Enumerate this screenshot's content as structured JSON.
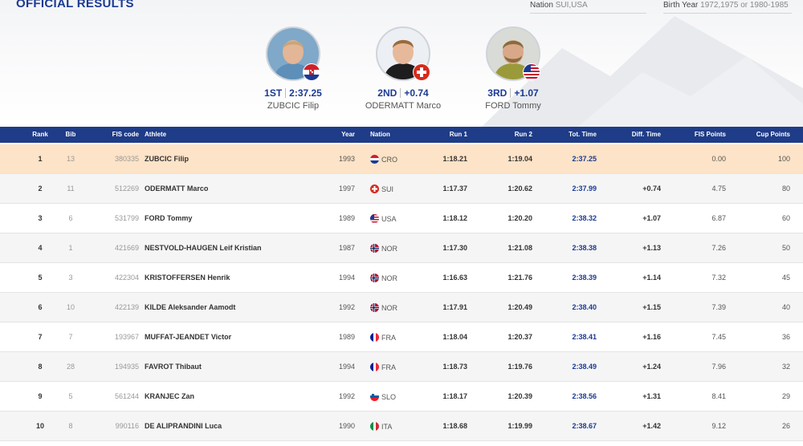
{
  "page": {
    "title": "OFFICIAL RESULTS"
  },
  "filters": {
    "nation_label": "Nation",
    "nation_value": "SUI,USA",
    "birth_label": "Birth Year",
    "birth_value": "1972,1975 or 1980-1985"
  },
  "podium": [
    {
      "place": "1ST",
      "time": "2:37.25",
      "name": "ZUBCIC Filip",
      "flag": "CRO"
    },
    {
      "place": "2ND",
      "time": "+0.74",
      "name": "ODERMATT Marco",
      "flag": "SUI"
    },
    {
      "place": "3RD",
      "time": "+1.07",
      "name": "FORD Tommy",
      "flag": "USA"
    }
  ],
  "table": {
    "headers": {
      "rank": "Rank",
      "bib": "Bib",
      "fis_code": "FIS code",
      "athlete": "Athlete",
      "year": "Year",
      "nation": "Nation",
      "run1": "Run 1",
      "run2": "Run 2",
      "tot": "Tot. Time",
      "diff": "Diff. Time",
      "fis_points": "FIS Points",
      "cup_points": "Cup Points"
    },
    "rows": [
      {
        "rank": "1",
        "bib": "13",
        "fis": "380335",
        "athlete": "ZUBCIC Filip",
        "year": "1993",
        "nation": "CRO",
        "run1": "1:18.21",
        "run2": "1:19.04",
        "tot": "2:37.25",
        "diff": "",
        "fisp": "0.00",
        "cup": "100"
      },
      {
        "rank": "2",
        "bib": "11",
        "fis": "512269",
        "athlete": "ODERMATT Marco",
        "year": "1997",
        "nation": "SUI",
        "run1": "1:17.37",
        "run2": "1:20.62",
        "tot": "2:37.99",
        "diff": "+0.74",
        "fisp": "4.75",
        "cup": "80"
      },
      {
        "rank": "3",
        "bib": "6",
        "fis": "531799",
        "athlete": "FORD Tommy",
        "year": "1989",
        "nation": "USA",
        "run1": "1:18.12",
        "run2": "1:20.20",
        "tot": "2:38.32",
        "diff": "+1.07",
        "fisp": "6.87",
        "cup": "60"
      },
      {
        "rank": "4",
        "bib": "1",
        "fis": "421669",
        "athlete": "NESTVOLD-HAUGEN Leif Kristian",
        "year": "1987",
        "nation": "NOR",
        "run1": "1:17.30",
        "run2": "1:21.08",
        "tot": "2:38.38",
        "diff": "+1.13",
        "fisp": "7.26",
        "cup": "50"
      },
      {
        "rank": "5",
        "bib": "3",
        "fis": "422304",
        "athlete": "KRISTOFFERSEN Henrik",
        "year": "1994",
        "nation": "NOR",
        "run1": "1:16.63",
        "run2": "1:21.76",
        "tot": "2:38.39",
        "diff": "+1.14",
        "fisp": "7.32",
        "cup": "45"
      },
      {
        "rank": "6",
        "bib": "10",
        "fis": "422139",
        "athlete": "KILDE Aleksander Aamodt",
        "year": "1992",
        "nation": "NOR",
        "run1": "1:17.91",
        "run2": "1:20.49",
        "tot": "2:38.40",
        "diff": "+1.15",
        "fisp": "7.39",
        "cup": "40"
      },
      {
        "rank": "7",
        "bib": "7",
        "fis": "193967",
        "athlete": "MUFFAT-JEANDET Victor",
        "year": "1989",
        "nation": "FRA",
        "run1": "1:18.04",
        "run2": "1:20.37",
        "tot": "2:38.41",
        "diff": "+1.16",
        "fisp": "7.45",
        "cup": "36"
      },
      {
        "rank": "8",
        "bib": "28",
        "fis": "194935",
        "athlete": "FAVROT Thibaut",
        "year": "1994",
        "nation": "FRA",
        "run1": "1:18.73",
        "run2": "1:19.76",
        "tot": "2:38.49",
        "diff": "+1.24",
        "fisp": "7.96",
        "cup": "32"
      },
      {
        "rank": "9",
        "bib": "5",
        "fis": "561244",
        "athlete": "KRANJEC Zan",
        "year": "1992",
        "nation": "SLO",
        "run1": "1:18.17",
        "run2": "1:20.39",
        "tot": "2:38.56",
        "diff": "+1.31",
        "fisp": "8.41",
        "cup": "29"
      },
      {
        "rank": "10",
        "bib": "8",
        "fis": "990116",
        "athlete": "DE ALIPRANDINI Luca",
        "year": "1990",
        "nation": "ITA",
        "run1": "1:18.68",
        "run2": "1:19.99",
        "tot": "2:38.67",
        "diff": "+1.42",
        "fisp": "9.12",
        "cup": "26"
      }
    ]
  },
  "colors": {
    "brand": "#1f3c88",
    "highlight": "#fde3c7"
  }
}
